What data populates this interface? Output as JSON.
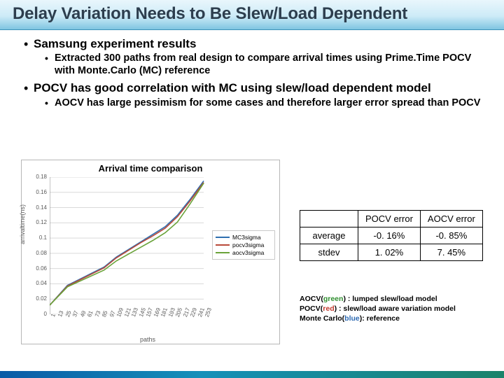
{
  "title": "Delay Variation Needs to Be Slew/Load Dependent",
  "bullets": {
    "b1": "Samsung experiment results",
    "b1_sub": "Extracted 300 paths from real design to compare arrival times using Prime.Time POCV with Monte.Carlo (MC) reference",
    "b2": "POCV has good correlation with MC using slew/load dependent model",
    "b2_sub": "AOCV has large pessimism for some cases and therefore larger error spread than POCV"
  },
  "table": {
    "h1": "POCV error",
    "h2": "AOCV error",
    "r1": "average",
    "r1v1": "-0. 16%",
    "r1v2": "-0. 85%",
    "r2": "stdev",
    "r2v1": "1. 02%",
    "r2v2": "7. 45%"
  },
  "caption": {
    "l1a": "AOCV(",
    "l1b": "green",
    "l1c": ") : lumped slew/load model",
    "l2a": "POCV(",
    "l2b": "red",
    "l2c": ") : slew/load aware variation model",
    "l3a": "Monte Carlo(",
    "l3b": "blue",
    "l3c": "): reference"
  },
  "chart_data": {
    "type": "line",
    "title": "Arrival time comparison",
    "xlabel": "paths",
    "ylabel": "arrivaltime(ns)",
    "ylim": [
      0,
      0.18
    ],
    "yticks": [
      0,
      0.02,
      0.04,
      0.06,
      0.08,
      0.1,
      0.12,
      0.14,
      0.16,
      0.18
    ],
    "xticks": [
      1,
      13,
      25,
      37,
      49,
      61,
      73,
      85,
      97,
      109,
      121,
      133,
      145,
      157,
      169,
      181,
      193,
      205,
      217,
      229,
      241,
      253
    ],
    "x": [
      1,
      30,
      60,
      90,
      110,
      130,
      150,
      170,
      190,
      210,
      230,
      253
    ],
    "series": [
      {
        "name": "MC3sigma",
        "color": "#2f6fb0",
        "values": [
          0.012,
          0.038,
          0.05,
          0.062,
          0.075,
          0.085,
          0.095,
          0.105,
          0.115,
          0.13,
          0.15,
          0.175
        ]
      },
      {
        "name": "pocv3sigma",
        "color": "#b94a3a",
        "values": [
          0.012,
          0.037,
          0.049,
          0.061,
          0.074,
          0.084,
          0.094,
          0.103,
          0.113,
          0.128,
          0.148,
          0.173
        ]
      },
      {
        "name": "aocv3sigma",
        "color": "#6aa33a",
        "values": [
          0.012,
          0.036,
          0.047,
          0.058,
          0.07,
          0.079,
          0.088,
          0.097,
          0.107,
          0.121,
          0.144,
          0.172
        ]
      }
    ],
    "legend_pos": "right"
  }
}
